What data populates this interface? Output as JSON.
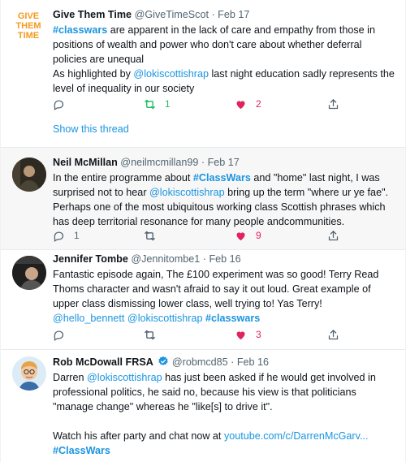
{
  "tweets": [
    {
      "name": "Give Them Time",
      "handle": "@GiveTimeScot",
      "dot": "·",
      "date": "Feb 17",
      "logo_lines": [
        "GIVE",
        "THEM",
        "TIME"
      ],
      "body_parts": [
        {
          "type": "tag",
          "text": "#classwars"
        },
        {
          "type": "text",
          "text": " are apparent in the lack of care and empathy from those in positions of wealth and power who don't care about whether deferral policies are unequal\nAs highlighted by "
        },
        {
          "type": "link",
          "text": "@lokiscottishrap"
        },
        {
          "type": "text",
          "text": "  last night education sadly represents the level of inequality in our society"
        }
      ],
      "reply_count": "",
      "retweet_count": "1",
      "like_count": "2",
      "retweeted": true,
      "liked": true,
      "show_thread": "Show this thread"
    },
    {
      "name": "Neil McMillan",
      "handle": "@neilmcmillan99",
      "dot": "·",
      "date": "Feb 17",
      "body_parts": [
        {
          "type": "text",
          "text": "In the entire programme about "
        },
        {
          "type": "tag",
          "text": "#ClassWars"
        },
        {
          "type": "text",
          "text": " and \"home\" last night, I was surprised not to hear "
        },
        {
          "type": "link",
          "text": "@lokiscottishrap"
        },
        {
          "type": "text",
          "text": " bring up the term \"where ur ye fae\". Perhaps one of the most ubiquitous working class Scottish phrases which has deep territorial resonance for many people andcommunities."
        }
      ],
      "reply_count": "1",
      "retweet_count": "",
      "like_count": "9",
      "retweeted": false,
      "liked": true
    },
    {
      "name": "Jennifer Tombe",
      "handle": "@Jennitombe1",
      "dot": "·",
      "date": "Feb 16",
      "body_parts": [
        {
          "type": "text",
          "text": "Fantastic episode again, The £100 experiment was so good! Terry Read Thoms character and wasn't afraid to say it out loud. Great example of upper class dismissing lower class, well trying to! Yas Terry!\n"
        },
        {
          "type": "link",
          "text": "@hello_bennett"
        },
        {
          "type": "text",
          "text": " "
        },
        {
          "type": "link",
          "text": "@lokiscottishrap"
        },
        {
          "type": "text",
          "text": "  "
        },
        {
          "type": "tag",
          "text": "#classwars"
        }
      ],
      "reply_count": "",
      "retweet_count": "",
      "like_count": "3",
      "retweeted": false,
      "liked": true
    },
    {
      "name": "Rob McDowall FRSA",
      "handle": "@robmcd85",
      "dot": "·",
      "date": "Feb 16",
      "verified": true,
      "body_parts": [
        {
          "type": "text",
          "text": "Darren "
        },
        {
          "type": "link",
          "text": "@lokiscottishrap"
        },
        {
          "type": "text",
          "text": " has just been asked if he would get involved in professional politics, he said no, because his view is that politicians \"manage change\" whereas he \"like[s] to drive it\".\n\nWatch his after party and chat now at "
        },
        {
          "type": "link",
          "text": "youtube.com/c/DarrenMcGarv..."
        },
        {
          "type": "text",
          "text": "\n"
        },
        {
          "type": "tag",
          "text": "#ClassWars"
        }
      ]
    }
  ],
  "colors": {
    "link": "#1b95e0",
    "retweet_active": "#17bf63",
    "like_active": "#e0245e",
    "muted": "#536471",
    "highlight_bg": "#f7f7f7",
    "logo_orange": "#f39a1e"
  },
  "icons": {
    "reply": "reply-icon",
    "retweet": "retweet-icon",
    "like": "heart-icon",
    "share": "share-icon",
    "verified": "verified-badge-icon"
  }
}
